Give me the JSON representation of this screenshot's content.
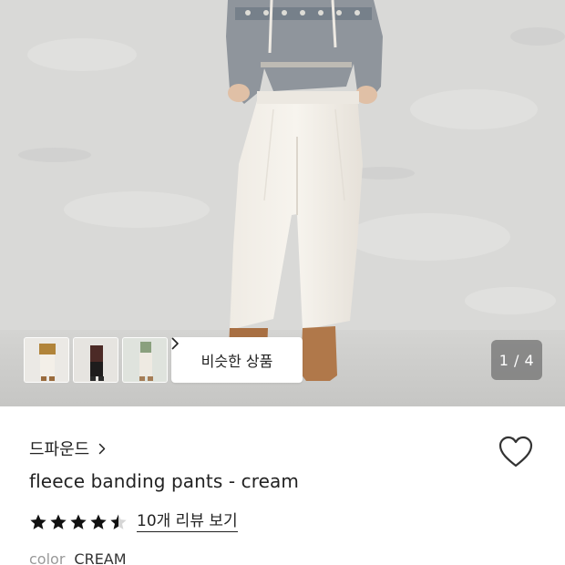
{
  "gallery": {
    "similar_button_label": "비슷한 상품",
    "pager_text": "1 / 4",
    "thumbnails": [
      "thumbnail-front",
      "thumbnail-sweater",
      "thumbnail-side"
    ]
  },
  "product": {
    "brand": "드파운드",
    "title": "fleece banding pants - cream",
    "rating": 4.5,
    "review_link": "10개 리뷰 보기",
    "color_label": "color",
    "color_value": "CREAM"
  },
  "icons": {
    "brand_chevron": "chevron-right-icon",
    "wishlist": "heart-icon",
    "star": "star-icon"
  }
}
